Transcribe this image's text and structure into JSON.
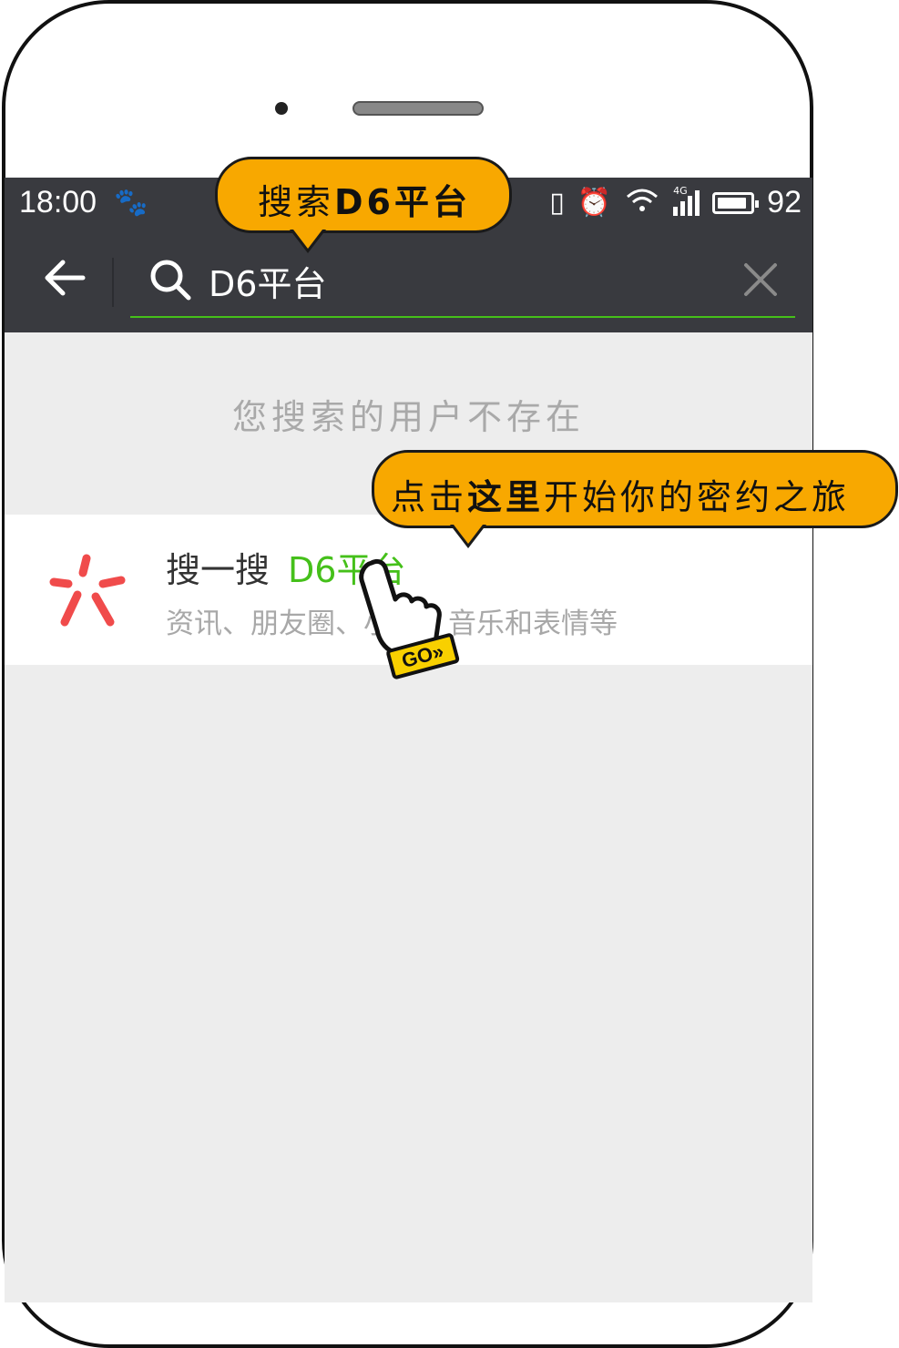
{
  "status_bar": {
    "time": "18:00",
    "baidu_icon": "paw-icon",
    "network_label": "4G",
    "battery_level": "92",
    "battery_fraction": 0.9
  },
  "search": {
    "query": "D6平台"
  },
  "messages": {
    "not_found": "您搜索的用户不存在"
  },
  "result": {
    "title_prefix": "搜一搜",
    "title_highlight": "D6平台",
    "subtitle": "资讯、朋友圈、小说、音乐和表情等"
  },
  "callouts": {
    "top_prefix": "搜索",
    "top_bold": "D6平台",
    "bottom_prefix": "点击",
    "bottom_bold": "这里",
    "bottom_suffix": "开始你的密约之旅"
  },
  "go_badge": "GO»",
  "colors": {
    "header_bg": "#393a3f",
    "accent_green": "#45c01a",
    "callout_orange": "#f8a800",
    "logo_red": "#f04b4b",
    "screen_bg": "#ededed"
  }
}
